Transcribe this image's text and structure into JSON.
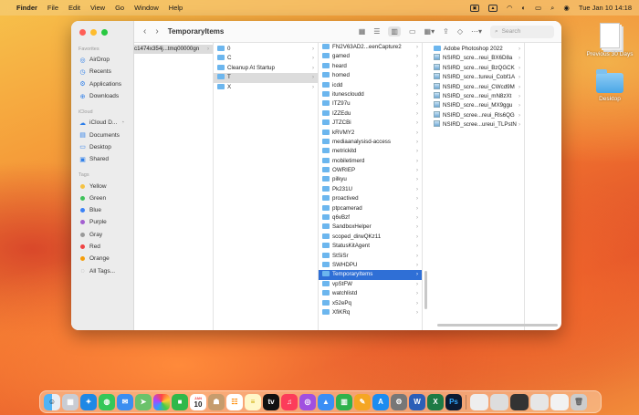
{
  "menubar": {
    "app": "Finder",
    "items": [
      "File",
      "Edit",
      "View",
      "Go",
      "Window",
      "Help"
    ],
    "datetime": "Tue Jan 10  14:18"
  },
  "desktop": {
    "items": [
      {
        "label": "Previous 30 Days",
        "icon": "document-stack-icon"
      },
      {
        "label": "Desktop",
        "icon": "folder-icon"
      }
    ]
  },
  "window": {
    "title": "TemporaryItems",
    "search_placeholder": "Search",
    "sidebar": {
      "favorites_header": "Favorites",
      "favorites": [
        {
          "label": "AirDrop",
          "icon": "airdrop-icon"
        },
        {
          "label": "Recents",
          "icon": "clock-icon"
        },
        {
          "label": "Applications",
          "icon": "applications-icon"
        },
        {
          "label": "Downloads",
          "icon": "download-icon"
        }
      ],
      "icloud_header": "iCloud",
      "icloud": [
        {
          "label": "iCloud D...",
          "icon": "cloud-icon"
        },
        {
          "label": "Documents",
          "icon": "document-icon"
        },
        {
          "label": "Desktop",
          "icon": "desktop-icon"
        },
        {
          "label": "Shared",
          "icon": "shared-folder-icon"
        }
      ],
      "tags_header": "Tags",
      "tags": [
        {
          "label": "Yellow",
          "color": "#f5c242"
        },
        {
          "label": "Green",
          "color": "#3fc25a"
        },
        {
          "label": "Blue",
          "color": "#3b82f6"
        },
        {
          "label": "Purple",
          "color": "#a35fd0"
        },
        {
          "label": "Gray",
          "color": "#9a9a9a"
        },
        {
          "label": "Red",
          "color": "#ef4444"
        },
        {
          "label": "Orange",
          "color": "#f59e0b"
        },
        {
          "label": "All Tags...",
          "color": ""
        }
      ]
    },
    "columns": {
      "col1": [
        "c1474x354j...tmq00000gn"
      ],
      "col2": [
        "0",
        "C",
        "Cleanup At Startup",
        "T",
        "X"
      ],
      "col3": [
        "FN2V63AD2...eenCapture2",
        "gamed",
        "heard",
        "homed",
        "icdd",
        "itunescloudd",
        "ITZ97u",
        "IZZEdu",
        "JTZCBi",
        "kRVMY2",
        "mediaanalysisd-access",
        "metrickitd",
        "mobiletimerd",
        "OWRIEP",
        "pilkyu",
        "Pk231U",
        "proactived",
        "ptpcamerad",
        "q6vBzf",
        "SandboxHelper",
        "scoped_dirwQKz11",
        "StatusKitAgent",
        "StSiSr",
        "SWHDPU",
        "TemporaryItems",
        "vpStFW",
        "watchlistd",
        "x52ePq",
        "XfiKRq"
      ],
      "col4": [
        "Adobe Photoshop 2022",
        "NSIRD_scre...reui_BX6D8a",
        "NSIRD_scre...reui_BzQGCK",
        "NSIRD_scre...tureui_Cobf1A",
        "NSIRD_scre...reui_CWcd9M",
        "NSIRD_scre...reui_mN8zXt",
        "NSIRD_scre...reui_MX9ggu",
        "NSIRD_scree...reui_Rls6QG",
        "NSIRD_scree...ureui_TLPstN"
      ]
    }
  },
  "dock": {
    "apps": [
      "Finder",
      "Launchpad",
      "Safari",
      "Messages",
      "Mail",
      "Maps",
      "Photos",
      "FaceTime",
      "Calendar",
      "Contacts",
      "Reminders",
      "Notes",
      "TV",
      "Music",
      "Podcasts",
      "Keynote",
      "Numbers",
      "Pages",
      "App Store",
      "System Settings",
      "Word",
      "Excel",
      "Photoshop",
      "Downloads",
      "Preview",
      "Trash"
    ],
    "calendar_month": "JAN",
    "calendar_day": "10"
  }
}
